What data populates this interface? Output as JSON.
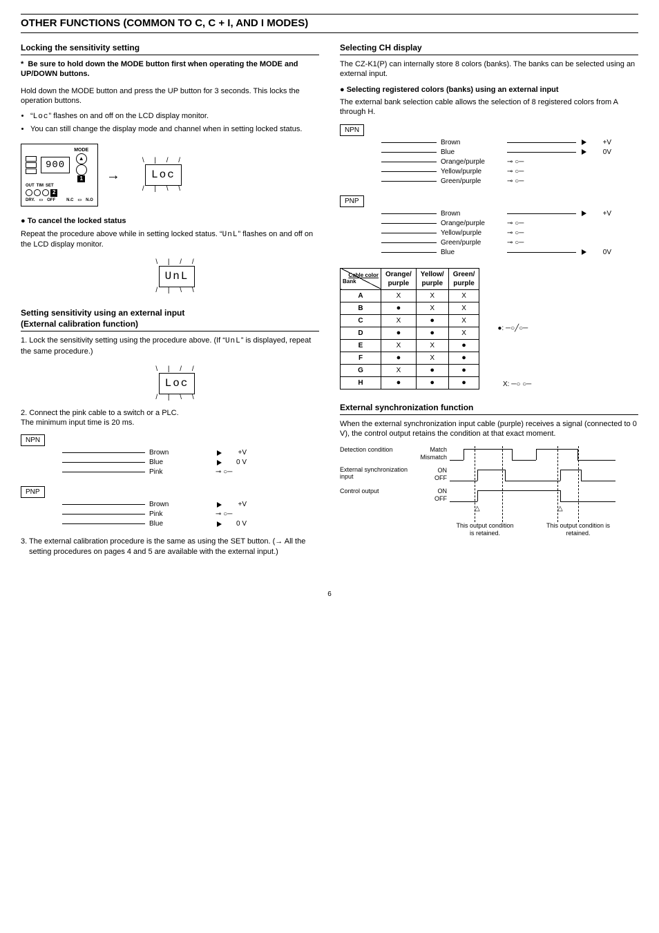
{
  "page": {
    "section_title": "OTHER FUNCTIONS (COMMON TO C, C + I, AND I MODES)",
    "page_number": "6"
  },
  "left": {
    "locking_heading": "Locking the sensitivity setting",
    "caution_note": "Be sure to hold down the MODE button first when operating the MODE and UP/DOWN buttons.",
    "p1": "Hold down the MODE button and press the UP button for 3 seconds. This locks the operation buttons.",
    "bullet1_pre": "“",
    "bullet1_seg": "Loc",
    "bullet1_post": "” flashes on and off on the LCD display monitor.",
    "bullet2": "You can still change the display mode and channel when in setting locked status.",
    "device_fig": {
      "mode_label": "MODE",
      "screen": "900",
      "out": "OUT",
      "tim": "TIM",
      "set": "SET",
      "dry": "DRY.",
      "off": "OFF",
      "nc": "N.C",
      "no": "N.O",
      "badge1": "1",
      "badge2": "2"
    },
    "lcd_loc": "Loc",
    "cancel_head": "To cancel the locked status",
    "cancel_p_pre": "Repeat the procedure above while in setting locked status. “",
    "cancel_seg": "UnL",
    "cancel_p_post": "” flashes on and off on the LCD display monitor.",
    "lcd_unl": "UnL",
    "extcal_heading_l1": "Setting sensitivity using an external input",
    "extcal_heading_l2": "(External calibration function)",
    "step1_pre": "1. Lock the sensitivity setting using the procedure above. (If “",
    "step1_seg": "UnL",
    "step1_post": "” is displayed, repeat the same procedure.)",
    "lcd_loc2": "Loc",
    "step2": "2. Connect the pink cable to a switch or a PLC.\nThe minimum input time is 20 ms.",
    "npn_label": "NPN",
    "pnp_label": "PNP",
    "wires": {
      "brown": "Brown",
      "blue": "Blue",
      "pink": "Pink",
      "plusv": "+V",
      "zerov": "0 V"
    },
    "step3": "3. The external calibration procedure is the same as using the SET button. (→ All the setting procedures on pages 4 and 5 are available with the external input.)"
  },
  "right": {
    "ch_heading": "Selecting CH display",
    "ch_p1": "The CZ-K1(P) can internally store 8 colors (banks). The banks can be selected using an external input.",
    "sel_head": "Selecting registered colors (banks) using an external input",
    "sel_p": "The external bank selection cable allows the selection of 8 registered colors from A through H.",
    "npn_label": "NPN",
    "pnp_label": "PNP",
    "wires": {
      "brown": "Brown",
      "blue": "Blue",
      "op": "Orange/purple",
      "yp": "Yellow/purple",
      "gp": "Green/purple",
      "plusv": "+V",
      "zerov": "0V"
    },
    "table": {
      "diag_top": "Cable color",
      "diag_bot": "Bank",
      "h1": "Orange/\npurple",
      "h2": "Yellow/\npurple",
      "h3": "Green/\npurple",
      "rows": [
        {
          "bank": "A",
          "c": [
            "X",
            "X",
            "X"
          ]
        },
        {
          "bank": "B",
          "c": [
            "●",
            "X",
            "X"
          ]
        },
        {
          "bank": "C",
          "c": [
            "X",
            "●",
            "X"
          ]
        },
        {
          "bank": "D",
          "c": [
            "●",
            "●",
            "X"
          ]
        },
        {
          "bank": "E",
          "c": [
            "X",
            "X",
            "●"
          ]
        },
        {
          "bank": "F",
          "c": [
            "●",
            "X",
            "●"
          ]
        },
        {
          "bank": "G",
          "c": [
            "X",
            "●",
            "●"
          ]
        },
        {
          "bank": "H",
          "c": [
            "●",
            "●",
            "●"
          ]
        }
      ]
    },
    "legend_closed": "●:",
    "legend_open": "X:",
    "sync_heading": "External synchronization function",
    "sync_p": "When the external synchronization input cable (purple) receives a signal (connected to 0 V), the control output retains the condition at that exact moment.",
    "timing": {
      "det_label": "Detection condition",
      "det_match": "Match",
      "det_mismatch": "Mismatch",
      "ext_label": "External synchronization input",
      "on": "ON",
      "off": "OFF",
      "ctrl_label": "Control output",
      "anno1": "This output condition is retained.",
      "anno2": "This output condition is retained."
    }
  }
}
